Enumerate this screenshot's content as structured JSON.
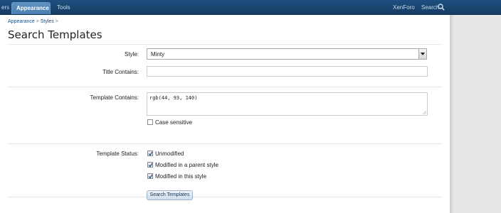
{
  "nav": {
    "tabs": [
      {
        "label": "ers"
      },
      {
        "label": "Appearance"
      },
      {
        "label": "Tools"
      }
    ],
    "right_link": "XenForo",
    "search_label": "Search"
  },
  "breadcrumb": {
    "items": [
      "Appearance",
      "Styles"
    ],
    "separator": ">"
  },
  "page": {
    "title": "Search Templates"
  },
  "form": {
    "style": {
      "label": "Style:",
      "selected": "Minty"
    },
    "title_contains": {
      "label": "Title Contains:",
      "value": ""
    },
    "template_contains": {
      "label": "Template Contains:",
      "value": "rgb(44, 93, 140)"
    },
    "case_sensitive": {
      "label": "Case sensitive",
      "checked": false
    },
    "template_status": {
      "label": "Template Status:",
      "options": [
        {
          "label": "Unmodified",
          "checked": true
        },
        {
          "label": "Modified in a parent style",
          "checked": true
        },
        {
          "label": "Modified in this style",
          "checked": true
        }
      ]
    },
    "submit_label": "Search Templates"
  },
  "colors": {
    "nav_bg": "#1e4f7e",
    "active_tab": "#5f92c2",
    "link": "#1d4f80"
  }
}
